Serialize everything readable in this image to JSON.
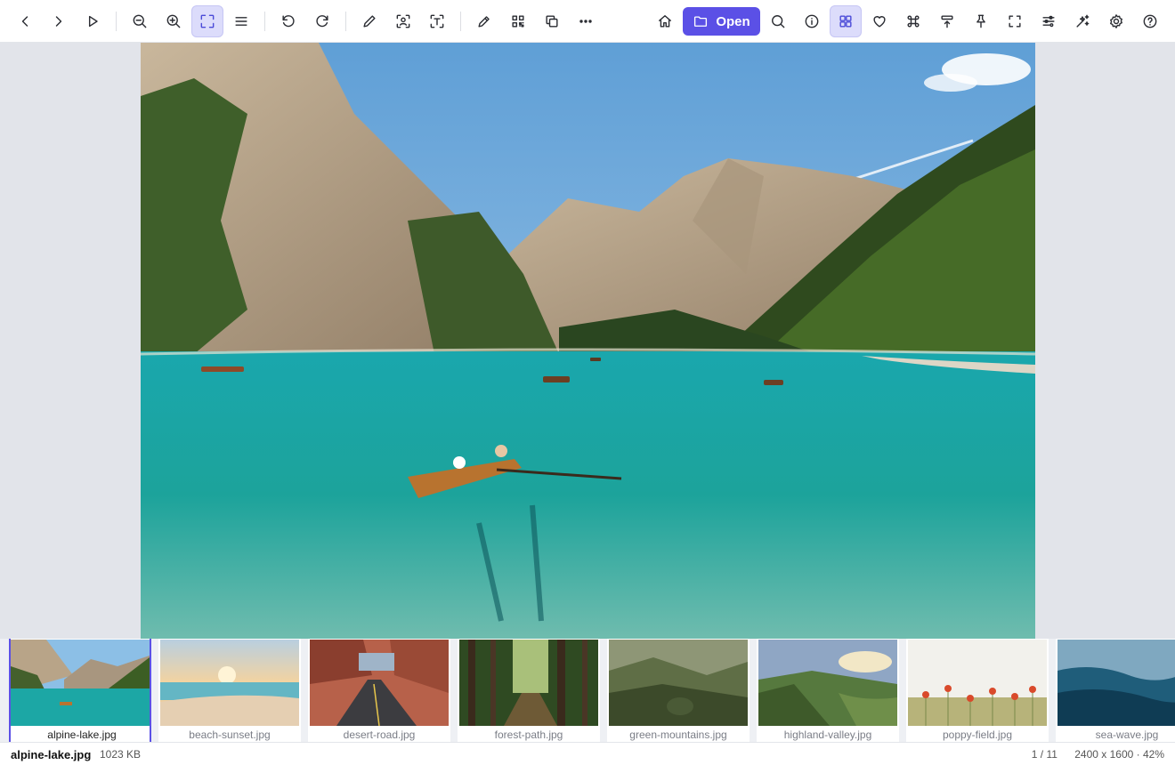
{
  "toolbar": {
    "left_buttons": [
      {
        "name": "previous-button",
        "icon": "chevron-left-icon"
      },
      {
        "name": "next-button",
        "icon": "chevron-right-icon"
      },
      {
        "name": "slideshow-button",
        "icon": "play-icon"
      },
      {
        "name": "zoom-out-button",
        "icon": "zoom-out-icon"
      },
      {
        "name": "zoom-in-button",
        "icon": "zoom-in-icon"
      },
      {
        "name": "fit-to-window-button",
        "icon": "fit-screen-icon",
        "active": true
      },
      {
        "name": "menu-button",
        "icon": "hamburger-icon"
      },
      {
        "name": "rotate-left-button",
        "icon": "rotate-ccw-icon"
      },
      {
        "name": "rotate-right-button",
        "icon": "rotate-cw-icon"
      },
      {
        "name": "edit-button",
        "icon": "pencil-icon"
      },
      {
        "name": "face-detect-button",
        "icon": "face-scan-icon"
      },
      {
        "name": "ocr-button",
        "icon": "text-scan-icon"
      },
      {
        "name": "annotate-button",
        "icon": "pen-icon"
      },
      {
        "name": "qr-code-button",
        "icon": "qr-code-icon"
      },
      {
        "name": "copy-button",
        "icon": "copy-icon"
      },
      {
        "name": "more-button",
        "icon": "more-horizontal-icon"
      }
    ],
    "open_label": "Open",
    "right_buttons": [
      {
        "name": "home-button",
        "icon": "home-icon"
      },
      {
        "name": "search-button",
        "icon": "search-icon"
      },
      {
        "name": "info-button",
        "icon": "info-icon"
      },
      {
        "name": "gallery-button",
        "icon": "grid-icon",
        "active": true
      },
      {
        "name": "favorite-button",
        "icon": "heart-icon"
      },
      {
        "name": "shortcuts-button",
        "icon": "command-icon"
      },
      {
        "name": "upload-button",
        "icon": "upload-icon"
      },
      {
        "name": "pin-button",
        "icon": "pin-icon"
      },
      {
        "name": "fullscreen-button",
        "icon": "fullscreen-icon"
      },
      {
        "name": "adjust-button",
        "icon": "sliders-icon"
      },
      {
        "name": "ai-enhance-button",
        "icon": "sparkles-icon"
      },
      {
        "name": "settings-button",
        "icon": "gear-icon"
      },
      {
        "name": "help-button",
        "icon": "help-icon"
      }
    ]
  },
  "filmstrip": {
    "items": [
      {
        "label": "alpine-lake.jpg",
        "selected": true
      },
      {
        "label": "beach-sunset.jpg"
      },
      {
        "label": "desert-road.jpg"
      },
      {
        "label": "forest-path.jpg"
      },
      {
        "label": "green-mountains.jpg"
      },
      {
        "label": "highland-valley.jpg"
      },
      {
        "label": "poppy-field.jpg"
      },
      {
        "label": "sea-wave.jpg"
      }
    ]
  },
  "status": {
    "filename": "alpine-lake.jpg",
    "filesize": "1023 KB",
    "position": "1 / 11",
    "dimensions": "2400 x 1600 · 42%"
  },
  "colors": {
    "accent": "#5b50e6",
    "active_bg": "#dcdcfb"
  }
}
